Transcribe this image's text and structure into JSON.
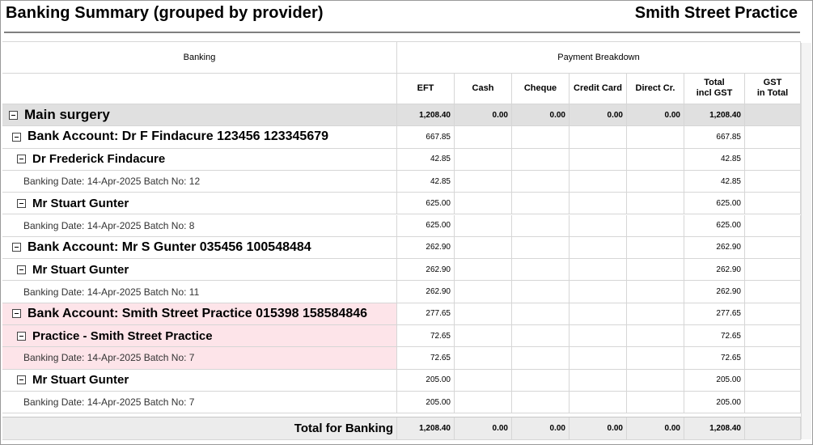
{
  "report": {
    "title": "Banking Summary (grouped by provider)",
    "practice": "Smith Street Practice"
  },
  "columns": {
    "banking": "Banking",
    "payment_breakdown": "Payment Breakdown",
    "eft": "EFT",
    "cash": "Cash",
    "cheque": "Cheque",
    "credit_card": "Credit Card",
    "direct_cr": "Direct Cr.",
    "total_incl_gst_1": "Total",
    "total_incl_gst_2": "incl GST",
    "gst_in_total_1": "GST",
    "gst_in_total_2": "in Total"
  },
  "rows": [
    {
      "level": 0,
      "label": "Main surgery",
      "eft": "1,208.40",
      "cash": "0.00",
      "cheque": "0.00",
      "credit": "0.00",
      "direct": "0.00",
      "total": "1,208.40",
      "gst": "",
      "style": "group0"
    },
    {
      "level": 1,
      "label": "Bank Account: Dr F Findacure 123456 123345679",
      "eft": "667.85",
      "cash": "",
      "cheque": "",
      "credit": "",
      "direct": "",
      "total": "667.85",
      "gst": "",
      "style": ""
    },
    {
      "level": 2,
      "label": "Dr Frederick Findacure",
      "eft": "42.85",
      "cash": "",
      "cheque": "",
      "credit": "",
      "direct": "",
      "total": "42.85",
      "gst": "",
      "style": ""
    },
    {
      "level": 3,
      "label": "Banking Date: 14-Apr-2025 Batch No: 12",
      "eft": "42.85",
      "cash": "",
      "cheque": "",
      "credit": "",
      "direct": "",
      "total": "42.85",
      "gst": "",
      "style": ""
    },
    {
      "level": 2,
      "label": "Mr Stuart Gunter",
      "eft": "625.00",
      "cash": "",
      "cheque": "",
      "credit": "",
      "direct": "",
      "total": "625.00",
      "gst": "",
      "style": ""
    },
    {
      "level": 3,
      "label": "Banking Date: 14-Apr-2025 Batch No: 8",
      "eft": "625.00",
      "cash": "",
      "cheque": "",
      "credit": "",
      "direct": "",
      "total": "625.00",
      "gst": "",
      "style": ""
    },
    {
      "level": 1,
      "label": "Bank Account: Mr S Gunter 035456 100548484",
      "eft": "262.90",
      "cash": "",
      "cheque": "",
      "credit": "",
      "direct": "",
      "total": "262.90",
      "gst": "",
      "style": ""
    },
    {
      "level": 2,
      "label": "Mr Stuart Gunter",
      "eft": "262.90",
      "cash": "",
      "cheque": "",
      "credit": "",
      "direct": "",
      "total": "262.90",
      "gst": "",
      "style": ""
    },
    {
      "level": 3,
      "label": "Banking Date: 14-Apr-2025 Batch No: 11",
      "eft": "262.90",
      "cash": "",
      "cheque": "",
      "credit": "",
      "direct": "",
      "total": "262.90",
      "gst": "",
      "style": ""
    },
    {
      "level": 1,
      "label": "Bank Account: Smith Street Practice 015398 158584846",
      "eft": "277.65",
      "cash": "",
      "cheque": "",
      "credit": "",
      "direct": "",
      "total": "277.65",
      "gst": "",
      "style": "pink"
    },
    {
      "level": 2,
      "label": "Practice - Smith Street Practice",
      "eft": "72.65",
      "cash": "",
      "cheque": "",
      "credit": "",
      "direct": "",
      "total": "72.65",
      "gst": "",
      "style": "pink"
    },
    {
      "level": 3,
      "label": "Banking Date: 14-Apr-2025 Batch No: 7",
      "eft": "72.65",
      "cash": "",
      "cheque": "",
      "credit": "",
      "direct": "",
      "total": "72.65",
      "gst": "",
      "style": "pink"
    },
    {
      "level": 2,
      "label": "Mr Stuart Gunter",
      "eft": "205.00",
      "cash": "",
      "cheque": "",
      "credit": "",
      "direct": "",
      "total": "205.00",
      "gst": "",
      "style": ""
    },
    {
      "level": 3,
      "label": "Banking Date: 14-Apr-2025 Batch No: 7",
      "eft": "205.00",
      "cash": "",
      "cheque": "",
      "credit": "",
      "direct": "",
      "total": "205.00",
      "gst": "",
      "style": ""
    }
  ],
  "total": {
    "label": "Total for Banking",
    "eft": "1,208.40",
    "cash": "0.00",
    "cheque": "0.00",
    "credit": "0.00",
    "direct": "0.00",
    "total": "1,208.40",
    "gst": ""
  },
  "colors": {
    "group_band": "#e0e0e0",
    "highlight_pink": "#fde4e9",
    "grid_line": "#d6d6d6"
  },
  "icons": {
    "expander": "collapse-minus-icon"
  }
}
